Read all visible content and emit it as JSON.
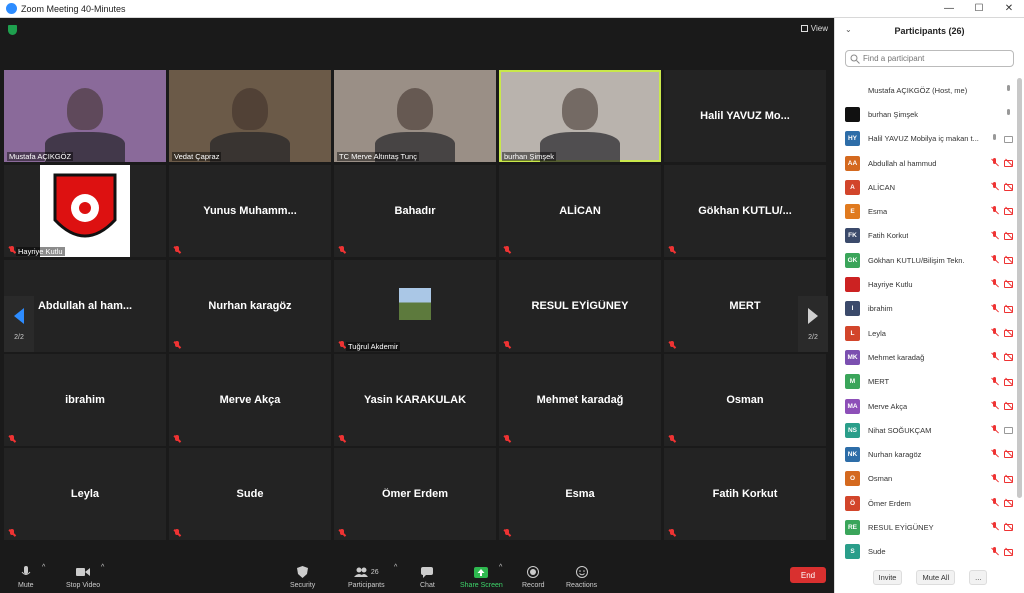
{
  "window": {
    "title": "Zoom Meeting 40-Minutes",
    "minimize": "—",
    "maximize": "☐",
    "close": "✕"
  },
  "meeting": {
    "view_label": "View",
    "page_indicator_left": "2/2",
    "page_indicator_right": "2/2",
    "tiles": [
      {
        "name": "Mustafa AÇIKGÖZ",
        "video": true,
        "muted": false,
        "color": "#8a6a9a"
      },
      {
        "name": "Vedat Çapraz",
        "video": true,
        "muted": false,
        "color": "#6b5a48"
      },
      {
        "name": "TC Merve Altıntaş Tunç",
        "video": true,
        "muted": false,
        "color": "#9a8f86"
      },
      {
        "name": "burhan Şimşek",
        "video": true,
        "muted": false,
        "active": true,
        "color": "#b9b3ad"
      },
      {
        "name": "Halil YAVUZ Mo...",
        "video": false,
        "muted": false
      },
      {
        "name": "Hayriye Kutlu",
        "video": false,
        "muted": true,
        "logo": true
      },
      {
        "name": "Yunus  Muhamm...",
        "video": false,
        "muted": true
      },
      {
        "name": "Bahadır",
        "video": false,
        "muted": true
      },
      {
        "name": "ALİCAN",
        "video": false,
        "muted": true
      },
      {
        "name": "Gökhan  KUTLU/...",
        "video": false,
        "muted": true
      },
      {
        "name": "Abdullah  al ham...",
        "video": false,
        "muted": true
      },
      {
        "name": "Nurhan karagöz",
        "video": false,
        "muted": true
      },
      {
        "name": "Tuğrul Akdemir",
        "video": false,
        "muted": true,
        "thumb": true
      },
      {
        "name": "RESUL EYİGÜNEY",
        "video": false,
        "muted": true
      },
      {
        "name": "MERT",
        "video": false,
        "muted": true
      },
      {
        "name": "ibrahim",
        "video": false,
        "muted": true
      },
      {
        "name": "Merve Akça",
        "video": false,
        "muted": true
      },
      {
        "name": "Yasin KARAKULAK",
        "video": false,
        "muted": true
      },
      {
        "name": "Mehmet karadağ",
        "video": false,
        "muted": true
      },
      {
        "name": "Osman",
        "video": false,
        "muted": true
      },
      {
        "name": "Leyla",
        "video": false,
        "muted": true
      },
      {
        "name": "Sude",
        "video": false,
        "muted": true
      },
      {
        "name": "Ömer Erdem",
        "video": false,
        "muted": true
      },
      {
        "name": "Esma",
        "video": false,
        "muted": true
      },
      {
        "name": "Fatih Korkut",
        "video": false,
        "muted": true
      }
    ]
  },
  "toolbar": {
    "mute": "Mute",
    "stop_video": "Stop Video",
    "security": "Security",
    "participants": "Participants",
    "participants_count": "26",
    "chat": "Chat",
    "share_screen": "Share Screen",
    "record": "Record",
    "reactions": "Reactions",
    "end": "End"
  },
  "panel": {
    "title": "Participants (26)",
    "search_placeholder": "Find a participant",
    "invite": "Invite",
    "mute_all": "Mute All",
    "more": "...",
    "participants": [
      {
        "initials": "",
        "name": "Mustafa AÇIKGÖZ (Host, me)",
        "color": "#ffffff",
        "muted": false,
        "cam_off": false
      },
      {
        "initials": "",
        "name": "burhan Şimşek",
        "color": "#111111",
        "muted": false,
        "cam_off": false
      },
      {
        "initials": "HY",
        "name": "Halil YAVUZ Mobilya iç makan t...",
        "color": "#2d6da8",
        "muted": false,
        "cam_off": false
      },
      {
        "initials": "AA",
        "name": "Abdullah al hammud",
        "color": "#d4691f",
        "muted": true,
        "cam_off": true
      },
      {
        "initials": "A",
        "name": "ALİCAN",
        "color": "#d2452b",
        "muted": true,
        "cam_off": true
      },
      {
        "initials": "E",
        "name": "Esma",
        "color": "#e07a1f",
        "muted": true,
        "cam_off": true
      },
      {
        "initials": "FK",
        "name": "Fatih Korkut",
        "color": "#3b4a6b",
        "muted": true,
        "cam_off": true
      },
      {
        "initials": "GK",
        "name": "Gökhan KUTLU/Bilişim Tekn.",
        "color": "#3aa55a",
        "muted": true,
        "cam_off": true
      },
      {
        "initials": "",
        "name": "Hayriye Kutlu",
        "color": "#cc2222",
        "muted": true,
        "cam_off": true
      },
      {
        "initials": "I",
        "name": "ibrahim",
        "color": "#3b4a6b",
        "muted": true,
        "cam_off": true
      },
      {
        "initials": "L",
        "name": "Leyla",
        "color": "#d2452b",
        "muted": true,
        "cam_off": true
      },
      {
        "initials": "MK",
        "name": "Mehmet karadağ",
        "color": "#7b4fb0",
        "muted": true,
        "cam_off": true
      },
      {
        "initials": "M",
        "name": "MERT",
        "color": "#3aa55a",
        "muted": true,
        "cam_off": true
      },
      {
        "initials": "MA",
        "name": "Merve Akça",
        "color": "#8d4fb8",
        "muted": true,
        "cam_off": true
      },
      {
        "initials": "NS",
        "name": "Nihat SOĞUKÇAM",
        "color": "#2a9e8a",
        "muted": true,
        "cam_off": false
      },
      {
        "initials": "NK",
        "name": "Nurhan karagöz",
        "color": "#2d6da8",
        "muted": true,
        "cam_off": true
      },
      {
        "initials": "O",
        "name": "Osman",
        "color": "#d4691f",
        "muted": true,
        "cam_off": true
      },
      {
        "initials": "Ö",
        "name": "Ömer Erdem",
        "color": "#d2452b",
        "muted": true,
        "cam_off": true
      },
      {
        "initials": "RE",
        "name": "RESUL EYİGÜNEY",
        "color": "#3aa55a",
        "muted": true,
        "cam_off": true
      },
      {
        "initials": "S",
        "name": "Sude",
        "color": "#2a9e8a",
        "muted": true,
        "cam_off": true
      }
    ]
  }
}
